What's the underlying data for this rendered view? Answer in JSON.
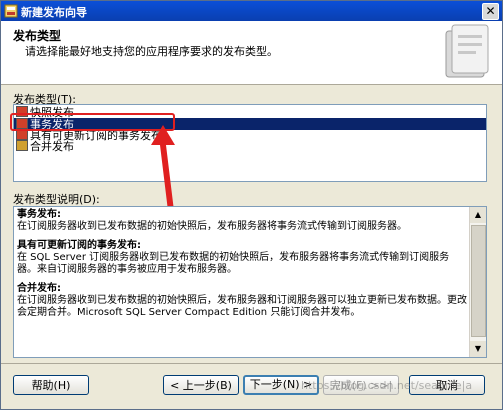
{
  "window": {
    "title": "新建发布向导",
    "close_glyph": "✕"
  },
  "header": {
    "title": "发布类型",
    "description": "请选择能最好地支持您的应用程序要求的发布类型。"
  },
  "publication_list": {
    "label": "发布类型(T):",
    "items": [
      {
        "label": "快照发布",
        "icon": "snapshot-icon",
        "color": "#d0402a"
      },
      {
        "label": "事务发布",
        "icon": "transaction-icon",
        "color": "#d0402a",
        "selected": true
      },
      {
        "label": "具有可更新订阅的事务发布",
        "icon": "updatable-icon",
        "color": "#d0402a"
      },
      {
        "label": "合并发布",
        "icon": "merge-icon",
        "color": "#d0a030"
      }
    ]
  },
  "description_section": {
    "label": "发布类型说明(D):",
    "entries": [
      {
        "title": "事务发布:",
        "text": "在订阅服务器收到已发布数据的初始快照后，发布服务器将事务流式传输到订阅服务器。"
      },
      {
        "title": "具有可更新订阅的事务发布:",
        "text": "在 SQL Server 订阅服务器收到已发布数据的初始快照后，发布服务器将事务流式传输到订阅服务器。来自订阅服务器的事务被应用于发布服务器。"
      },
      {
        "title": "合并发布:",
        "text": "在订阅服务器收到已发布数据的初始快照后，发布服务器和订阅服务器可以独立更新已发布数据。更改会定期合并。Microsoft SQL Server Compact Edition 只能订阅合并发布。"
      }
    ]
  },
  "buttons": {
    "help": "帮助(H)",
    "back": "< 上一步(B)",
    "next": "下一步(N) >",
    "finish": "完成(F) >>|",
    "cancel": "取消"
  },
  "watermark": "https://blog.csdn.net/seagine|a",
  "colors": {
    "accent": "#0a246a",
    "highlight": "#e02020"
  }
}
